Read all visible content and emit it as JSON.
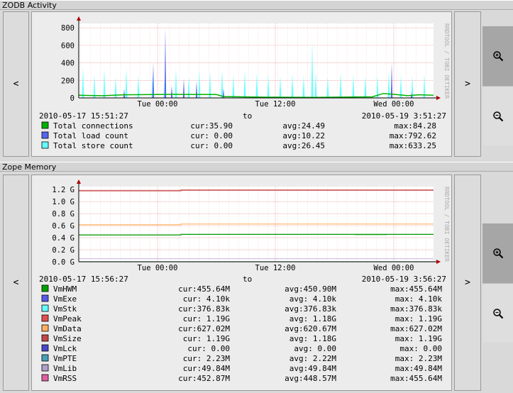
{
  "sections": [
    {
      "title": "ZODB Activity"
    },
    {
      "title": "Zope Memory"
    }
  ],
  "nav": {
    "prev_label": "<",
    "next_label": ">"
  },
  "watermark": "RRDTOOL / TOBI OETIKER",
  "chart_data": [
    {
      "type": "area",
      "title": "ZODB Activity",
      "x_ticks": [
        "Tue 00:00",
        "Tue 12:00",
        "Wed 00:00"
      ],
      "y_ticks": [
        "800",
        "600",
        "400",
        "200",
        "0"
      ],
      "ylim": [
        0,
        850
      ],
      "start": "2010-05-17 15:51:27",
      "to_label": "to",
      "end": "2010-05-19 3:51:27",
      "series": [
        {
          "name": "Total connections",
          "color": "#00b000",
          "cur": "cur:35.90",
          "avg": "avg:24.49",
          "max": "max:84.28"
        },
        {
          "name": "Total load count",
          "color": "#5566ee",
          "cur": "cur: 0.00",
          "avg": "avg:10.22",
          "max": "max:792.62"
        },
        {
          "name": "Total store count",
          "color": "#66ffff",
          "cur": "cur: 0.00",
          "avg": "avg:26.45",
          "max": "max:633.25"
        }
      ]
    },
    {
      "type": "line",
      "title": "Zope Memory",
      "x_ticks": [
        "Tue 00:00",
        "Tue 12:00",
        "Wed 00:00"
      ],
      "y_ticks": [
        "1.2 G",
        "1.0 G",
        "0.8 G",
        "0.6 G",
        "0.4 G",
        "0.2 G",
        "0.0 G"
      ],
      "ylim": [
        0,
        1.25
      ],
      "start": "2010-05-17 15:56:27",
      "to_label": "to",
      "end": "2010-05-19 3:56:27",
      "series": [
        {
          "name": "VmHWM",
          "color": "#00a000",
          "cur": "cur:455.64M",
          "avg": "avg:450.90M",
          "max": "max:455.64M"
        },
        {
          "name": "VmExe",
          "color": "#5a5ae6",
          "cur": "cur: 4.10k",
          "avg": "avg: 4.10k",
          "max": "max: 4.10k"
        },
        {
          "name": "VmStk",
          "color": "#66ffff",
          "cur": "cur:376.83k",
          "avg": "avg:376.83k",
          "max": "max:376.83k"
        },
        {
          "name": "VmPeak",
          "color": "#e05050",
          "cur": "cur: 1.19G",
          "avg": "avg: 1.18G",
          "max": "max: 1.19G"
        },
        {
          "name": "VmData",
          "color": "#ffb060",
          "cur": "cur:627.02M",
          "avg": "avg:620.67M",
          "max": "max:627.02M"
        },
        {
          "name": "VmSize",
          "color": "#c04848",
          "cur": "cur: 1.19G",
          "avg": "avg: 1.18G",
          "max": "max: 1.19G"
        },
        {
          "name": "VmLck",
          "color": "#4848c8",
          "cur": "cur: 0.00",
          "avg": "avg: 0.00",
          "max": "max: 0.00"
        },
        {
          "name": "VmPTE",
          "color": "#4aa0b8",
          "cur": "cur: 2.23M",
          "avg": "avg: 2.22M",
          "max": "max: 2.23M"
        },
        {
          "name": "VmLib",
          "color": "#b0a0c8",
          "cur": "cur:49.84M",
          "avg": "avg:49.84M",
          "max": "max:49.84M"
        },
        {
          "name": "VmRSS",
          "color": "#e060a0",
          "cur": "cur:452.87M",
          "avg": "avg:448.57M",
          "max": "max:455.64M"
        }
      ]
    }
  ]
}
